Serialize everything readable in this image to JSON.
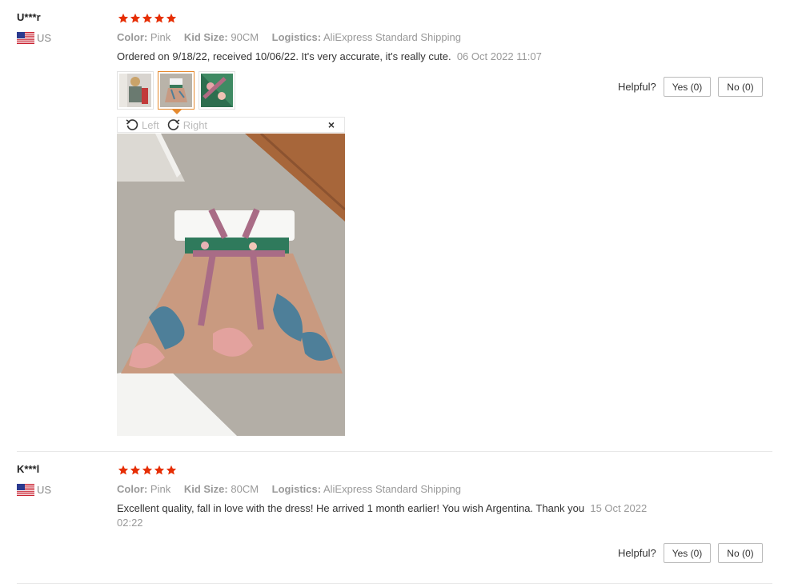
{
  "colors": {
    "star": "#e62e04",
    "date": "#999999",
    "accent": "#e58a2f"
  },
  "reviews": [
    {
      "user": "U***r",
      "country": "US",
      "rating": 5,
      "color_key": "Color:",
      "color_val": "Pink",
      "size_key": "Kid Size:",
      "size_val": "90CM",
      "logistics_key": "Logistics:",
      "logistics_val": "AliExpress Standard Shipping",
      "text": "Ordered on 9/18/22, received 10/06/22. It's very accurate, it's really cute.",
      "date": "06 Oct 2022 11:07",
      "helpful_label": "Helpful?",
      "yes_label": "Yes (0)",
      "no_label": "No (0)"
    },
    {
      "user": "K***l",
      "country": "US",
      "rating": 5,
      "color_key": "Color:",
      "color_val": "Pink",
      "size_key": "Kid Size:",
      "size_val": "80CM",
      "logistics_key": "Logistics:",
      "logistics_val": "AliExpress Standard Shipping",
      "text": "Excellent quality, fall in love with the dress! He arrived 1 month earlier! You wish Argentina. Thank you",
      "date_line1": "15 Oct 2022",
      "date_line2": "02:22",
      "helpful_label": "Helpful?",
      "yes_label": "Yes (0)",
      "no_label": "No (0)"
    }
  ],
  "viewer": {
    "left_label": "Left",
    "right_label": "Right",
    "close": "×",
    "icons": [
      "rotate-left-icon",
      "rotate-right-icon",
      "close-icon"
    ]
  }
}
